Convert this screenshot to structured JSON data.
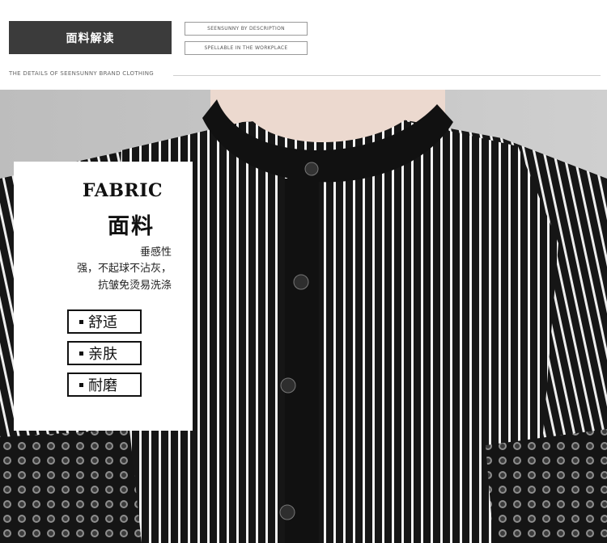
{
  "header": {
    "badge": "面料解读",
    "tagline_1": "SEENSUNNY BY DESCRIPTION",
    "tagline_2": "SPELLABLE IN THE WORKPLACE",
    "subtitle": "THE DETAILS OF SEENSUNNY BRAND CLOTHING"
  },
  "card": {
    "title_en": "FABRIC",
    "title_cn": "面料",
    "desc": [
      "垂感性",
      "强，不起球不沾灰，",
      "抗皱免烫易洗涤"
    ],
    "features": [
      "舒适",
      "亲肤",
      "耐磨"
    ]
  },
  "colors": {
    "badge_bg": "#3b3b3b",
    "shirt_black": "#161616",
    "stripe_white": "#f2f2f2",
    "background_gray": "#c9c9c9",
    "skin": "#ecd9cf"
  }
}
